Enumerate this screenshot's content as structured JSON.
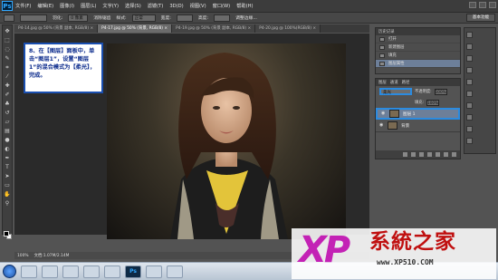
{
  "app": {
    "logo": "Ps",
    "menu": [
      "文件(F)",
      "编辑(E)",
      "图像(I)",
      "图层(L)",
      "文字(Y)",
      "选择(S)",
      "滤镜(T)",
      "3D(D)",
      "视图(V)",
      "窗口(W)",
      "帮助(H)"
    ]
  },
  "options": {
    "feather_label": "羽化:",
    "feather_value": "0 像素",
    "antialias_label": "消除锯齿",
    "style_label": "样式:",
    "style_value": "正常",
    "width_label": "宽度:",
    "height_label": "高度:",
    "refine_edge": "调整边缘...",
    "workspace": "基本功能"
  },
  "tabs": [
    "P4-14.jpg @ 50% (背景 副本, RGB/8) ×",
    "P4-17.jpg @ 50% (背景, RGB/8) ×",
    "P4-19.jpg @ 50% (背景 副本, RGB/8) ×",
    "P4-20.jpg @ 100%(RGB/8) ×"
  ],
  "callout": {
    "text": "8、在【图层】面板中，单击“图层1”，设置“图层1”的混合模式为【柔光】，完成。"
  },
  "status": {
    "zoom": "100%",
    "doc": "文档:1.07M/2.14M"
  },
  "history": {
    "tabs": [
      "历史记录"
    ],
    "items": [
      "打开",
      "新建图层",
      "填充",
      "图层属性"
    ],
    "selected": 3
  },
  "right_icons": [
    "",
    "",
    "",
    "",
    "",
    "",
    "",
    "",
    "",
    ""
  ],
  "layers": {
    "tabs": [
      "图层",
      "通道",
      "路径"
    ],
    "blend_mode": "柔光",
    "opacity_label": "不透明度:",
    "opacity": "100%",
    "fill_label": "填充:",
    "fill": "100%",
    "items": [
      "图层 1",
      "背景"
    ],
    "selected": 0
  },
  "taskbar": {
    "apps": [
      "",
      "",
      "",
      "",
      "",
      "Ps",
      "",
      ""
    ]
  },
  "watermark": {
    "logo": "XP",
    "name": "系統之家",
    "url": "www.XP510.COM"
  },
  "colors": {
    "highlight": "#2b8be0",
    "watermark_magenta": "#c322b5",
    "watermark_red": "#c01010"
  }
}
